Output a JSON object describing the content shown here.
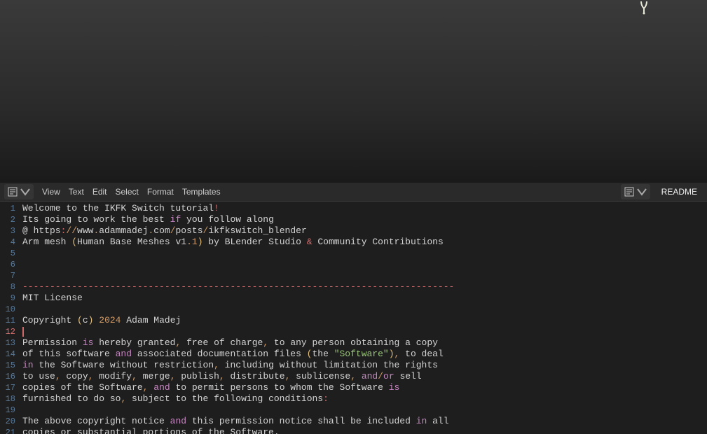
{
  "menus": {
    "view": "View",
    "text": "Text",
    "edit": "Edit",
    "select": "Select",
    "format": "Format",
    "templates": "Templates"
  },
  "file_name": "README",
  "current_line": 12,
  "lines": [
    {
      "num": 1,
      "tokens": [
        {
          "t": "text",
          "v": "Welcome to the IKFK Switch tutorial"
        },
        {
          "t": "punct-red",
          "v": "!"
        }
      ]
    },
    {
      "num": 2,
      "tokens": [
        {
          "t": "text",
          "v": "Its going to work the best "
        },
        {
          "t": "keyword",
          "v": "if"
        },
        {
          "t": "text",
          "v": " you follow along"
        }
      ]
    },
    {
      "num": 3,
      "tokens": [
        {
          "t": "text",
          "v": "@ https"
        },
        {
          "t": "punct-red",
          "v": ":"
        },
        {
          "t": "punct",
          "v": "//"
        },
        {
          "t": "text",
          "v": "www"
        },
        {
          "t": "punct",
          "v": "."
        },
        {
          "t": "text",
          "v": "adammadej"
        },
        {
          "t": "punct",
          "v": "."
        },
        {
          "t": "text",
          "v": "com"
        },
        {
          "t": "punct",
          "v": "/"
        },
        {
          "t": "text",
          "v": "posts"
        },
        {
          "t": "punct",
          "v": "/"
        },
        {
          "t": "text",
          "v": "ikfkswitch_blender"
        }
      ]
    },
    {
      "num": 4,
      "tokens": [
        {
          "t": "text",
          "v": "Arm mesh "
        },
        {
          "t": "bracket",
          "v": "("
        },
        {
          "t": "text",
          "v": "Human Base Meshes v1"
        },
        {
          "t": "punct",
          "v": "."
        },
        {
          "t": "number",
          "v": "1"
        },
        {
          "t": "bracket",
          "v": ")"
        },
        {
          "t": "text",
          "v": " by BLender Studio "
        },
        {
          "t": "punct-red",
          "v": "&"
        },
        {
          "t": "text",
          "v": " Community Contributions"
        }
      ]
    },
    {
      "num": 5,
      "tokens": []
    },
    {
      "num": 6,
      "tokens": []
    },
    {
      "num": 7,
      "tokens": []
    },
    {
      "num": 8,
      "tokens": [
        {
          "t": "dash",
          "v": "-------------------------------------------------------------------------------"
        }
      ]
    },
    {
      "num": 9,
      "tokens": [
        {
          "t": "text",
          "v": "MIT License"
        }
      ]
    },
    {
      "num": 10,
      "tokens": []
    },
    {
      "num": 11,
      "tokens": [
        {
          "t": "text",
          "v": "Copyright "
        },
        {
          "t": "bracket",
          "v": "("
        },
        {
          "t": "text",
          "v": "c"
        },
        {
          "t": "bracket",
          "v": ")"
        },
        {
          "t": "text",
          "v": " "
        },
        {
          "t": "number",
          "v": "2024"
        },
        {
          "t": "text",
          "v": " Adam Madej"
        }
      ]
    },
    {
      "num": 12,
      "tokens": [
        {
          "t": "cursor",
          "v": ""
        }
      ]
    },
    {
      "num": 13,
      "tokens": [
        {
          "t": "text",
          "v": "Permission "
        },
        {
          "t": "keyword",
          "v": "is"
        },
        {
          "t": "text",
          "v": " hereby granted"
        },
        {
          "t": "punct",
          "v": ","
        },
        {
          "t": "text",
          "v": " free of charge"
        },
        {
          "t": "punct",
          "v": ","
        },
        {
          "t": "text",
          "v": " to any person obtaining a copy"
        }
      ]
    },
    {
      "num": 14,
      "tokens": [
        {
          "t": "text",
          "v": "of this software "
        },
        {
          "t": "and",
          "v": "and"
        },
        {
          "t": "text",
          "v": " associated documentation files "
        },
        {
          "t": "bracket",
          "v": "("
        },
        {
          "t": "text",
          "v": "the "
        },
        {
          "t": "string",
          "v": "\"Software\""
        },
        {
          "t": "bracket",
          "v": ")"
        },
        {
          "t": "punct",
          "v": ","
        },
        {
          "t": "text",
          "v": " to deal"
        }
      ]
    },
    {
      "num": 15,
      "tokens": [
        {
          "t": "keyword",
          "v": "in"
        },
        {
          "t": "text",
          "v": " the Software without restriction"
        },
        {
          "t": "punct",
          "v": ","
        },
        {
          "t": "text",
          "v": " including without limitation the rights"
        }
      ]
    },
    {
      "num": 16,
      "tokens": [
        {
          "t": "text",
          "v": "to use"
        },
        {
          "t": "punct",
          "v": ","
        },
        {
          "t": "text",
          "v": " copy"
        },
        {
          "t": "punct",
          "v": ","
        },
        {
          "t": "text",
          "v": " modify"
        },
        {
          "t": "punct",
          "v": ","
        },
        {
          "t": "text",
          "v": " merge"
        },
        {
          "t": "punct",
          "v": ","
        },
        {
          "t": "text",
          "v": " publish"
        },
        {
          "t": "punct",
          "v": ","
        },
        {
          "t": "text",
          "v": " distribute"
        },
        {
          "t": "punct",
          "v": ","
        },
        {
          "t": "text",
          "v": " sublicense"
        },
        {
          "t": "punct",
          "v": ","
        },
        {
          "t": "text",
          "v": " "
        },
        {
          "t": "and",
          "v": "and"
        },
        {
          "t": "punct",
          "v": "/"
        },
        {
          "t": "keyword",
          "v": "or"
        },
        {
          "t": "text",
          "v": " sell"
        }
      ]
    },
    {
      "num": 17,
      "tokens": [
        {
          "t": "text",
          "v": "copies of the Software"
        },
        {
          "t": "punct",
          "v": ","
        },
        {
          "t": "text",
          "v": " "
        },
        {
          "t": "and",
          "v": "and"
        },
        {
          "t": "text",
          "v": " to permit persons to whom the Software "
        },
        {
          "t": "keyword",
          "v": "is"
        }
      ]
    },
    {
      "num": 18,
      "tokens": [
        {
          "t": "text",
          "v": "furnished to do so"
        },
        {
          "t": "punct",
          "v": ","
        },
        {
          "t": "text",
          "v": " subject to the following conditions"
        },
        {
          "t": "punct-red",
          "v": ":"
        }
      ]
    },
    {
      "num": 19,
      "tokens": []
    },
    {
      "num": 20,
      "tokens": [
        {
          "t": "text",
          "v": "The above copyright notice "
        },
        {
          "t": "and",
          "v": "and"
        },
        {
          "t": "text",
          "v": " this permission notice shall be included "
        },
        {
          "t": "keyword",
          "v": "in"
        },
        {
          "t": "text",
          "v": " all"
        }
      ]
    },
    {
      "num": 21,
      "tokens": [
        {
          "t": "text",
          "v": "copies or substantial portions of the Software."
        }
      ]
    }
  ]
}
